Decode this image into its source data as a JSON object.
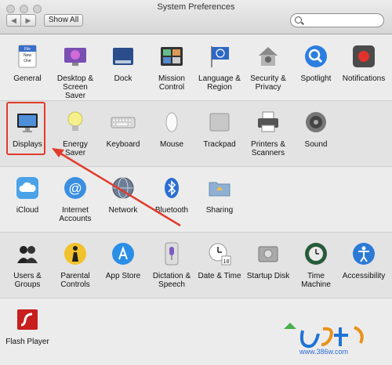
{
  "window": {
    "title": "System Preferences"
  },
  "toolbar": {
    "back": "◀",
    "forward": "▶",
    "show_all": "Show All"
  },
  "search": {
    "value": "",
    "placeholder": ""
  },
  "rows": [
    [
      "General",
      "Desktop & Screen Saver",
      "Dock",
      "Mission Control",
      "Language & Region",
      "Security & Privacy",
      "Spotlight",
      "Notifications"
    ],
    [
      "Displays",
      "Energy Saver",
      "Keyboard",
      "Mouse",
      "Trackpad",
      "Printers & Scanners",
      "Sound"
    ],
    [
      "iCloud",
      "Internet Accounts",
      "Network",
      "Bluetooth",
      "Sharing"
    ],
    [
      "Users & Groups",
      "Parental Controls",
      "App Store",
      "Dictation & Speech",
      "Date & Time",
      "Startup Disk",
      "Time Machine",
      "Accessibility"
    ],
    [
      "Flash Player"
    ]
  ],
  "labels": {
    "general": "General",
    "desktop": "Desktop & Screen Saver",
    "dock": "Dock",
    "mission": "Mission Control",
    "language": "Language & Region",
    "security": "Security & Privacy",
    "spotlight": "Spotlight",
    "notifications": "Notifications",
    "displays": "Displays",
    "energy": "Energy Saver",
    "keyboard": "Keyboard",
    "mouse": "Mouse",
    "trackpad": "Trackpad",
    "printers": "Printers & Scanners",
    "sound": "Sound",
    "icloud": "iCloud",
    "internet": "Internet Accounts",
    "network": "Network",
    "bluetooth": "Bluetooth",
    "sharing": "Sharing",
    "users": "Users & Groups",
    "parental": "Parental Controls",
    "appstore": "App Store",
    "dictation": "Dictation & Speech",
    "datetime": "Date & Time",
    "startup": "Startup Disk",
    "timemachine": "Time Machine",
    "accessibility": "Accessibility",
    "flash": "Flash Player"
  },
  "general_icon_text": {
    "file": "File",
    "new": "New",
    "one": "One"
  },
  "calendar_day": "18",
  "watermark": {
    "url": "www.386w.com"
  },
  "colors": {
    "highlight": "#e03b2c",
    "arrow": "#e03b2c"
  }
}
